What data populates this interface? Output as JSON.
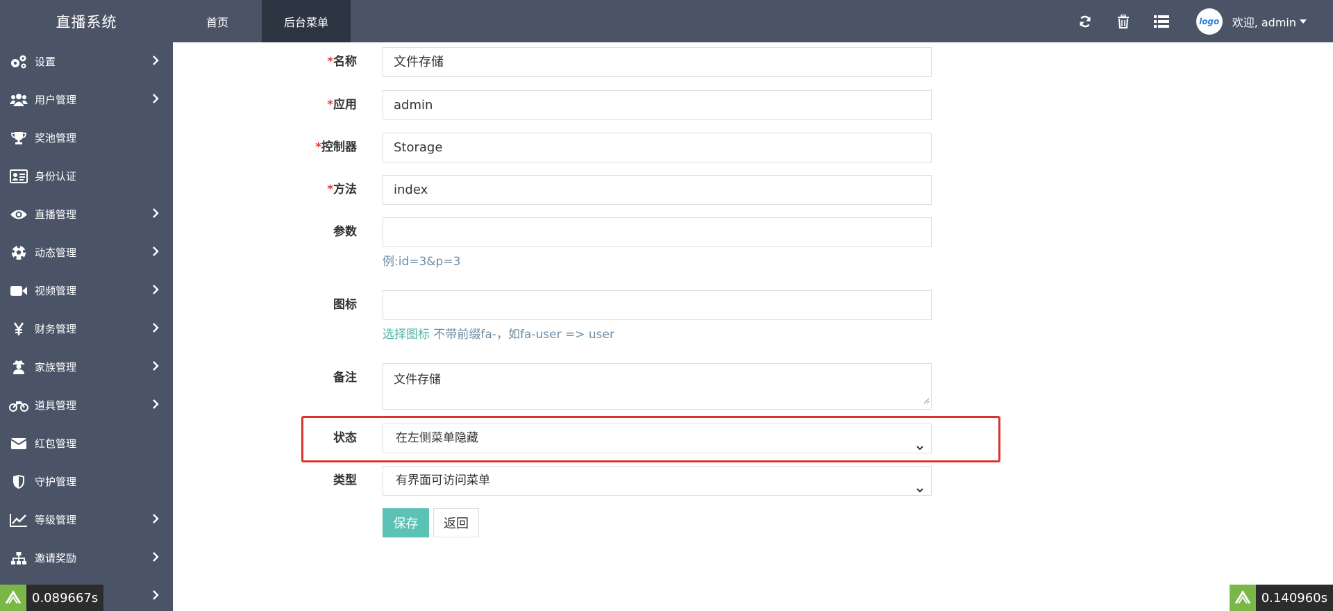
{
  "header": {
    "brand": "直播系统",
    "nav": [
      "首页",
      "后台菜单"
    ],
    "active_nav": "后台菜单",
    "tools": [
      "refresh-icon",
      "trash-icon",
      "list-icon"
    ],
    "avatar_text": "logo",
    "welcome": "欢迎, admin"
  },
  "sidebar": {
    "items": [
      {
        "label": "设置",
        "icon": "gears-icon",
        "has_children": true
      },
      {
        "label": "用户管理",
        "icon": "users-icon",
        "has_children": true
      },
      {
        "label": "奖池管理",
        "icon": "trophy-icon",
        "has_children": false
      },
      {
        "label": "身份认证",
        "icon": "id-card-icon",
        "has_children": false
      },
      {
        "label": "直播管理",
        "icon": "eye-icon",
        "has_children": true
      },
      {
        "label": "动态管理",
        "icon": "soccer-ball-icon",
        "has_children": true
      },
      {
        "label": "视频管理",
        "icon": "video-camera-icon",
        "has_children": true
      },
      {
        "label": "财务管理",
        "icon": "yen-icon",
        "has_children": true
      },
      {
        "label": "家族管理",
        "icon": "user-secret-icon",
        "has_children": true
      },
      {
        "label": "道具管理",
        "icon": "motorcycle-icon",
        "has_children": true
      },
      {
        "label": "红包管理",
        "icon": "envelope-icon",
        "has_children": false
      },
      {
        "label": "守护管理",
        "icon": "shield-icon",
        "has_children": false
      },
      {
        "label": "等级管理",
        "icon": "line-chart-icon",
        "has_children": true
      },
      {
        "label": "邀请奖励",
        "icon": "sitemap-icon",
        "has_children": true
      },
      {
        "label": "",
        "icon": "",
        "has_children": true
      }
    ]
  },
  "form": {
    "name": {
      "label": "名称",
      "required": "*",
      "value": "文件存储"
    },
    "app": {
      "label": "应用",
      "required": "*",
      "value": "admin"
    },
    "controller": {
      "label": "控制器",
      "required": "*",
      "value": "Storage"
    },
    "action": {
      "label": "方法",
      "required": "*",
      "value": "index"
    },
    "params": {
      "label": "参数",
      "value": "",
      "help": "例:id=3&p=3"
    },
    "icon": {
      "label": "图标",
      "value": "",
      "help_link": "选择图标",
      "help": " 不带前缀fa-，如fa-user => user"
    },
    "remark": {
      "label": "备注",
      "value": "文件存储"
    },
    "status": {
      "label": "状态",
      "selected": "在左侧菜单隐藏"
    },
    "type": {
      "label": "类型",
      "selected": "有界面可访问菜单"
    },
    "save_label": "保存",
    "back_label": "返回"
  },
  "timers": {
    "left": "0.089667s",
    "right": "0.140960s"
  },
  "colors": {
    "sidebar_bg": "#4b5467",
    "active_nav_bg": "#2d3442",
    "required": "#e4393c",
    "save_btn": "#5cc2b6",
    "highlight": "#d9342b"
  }
}
